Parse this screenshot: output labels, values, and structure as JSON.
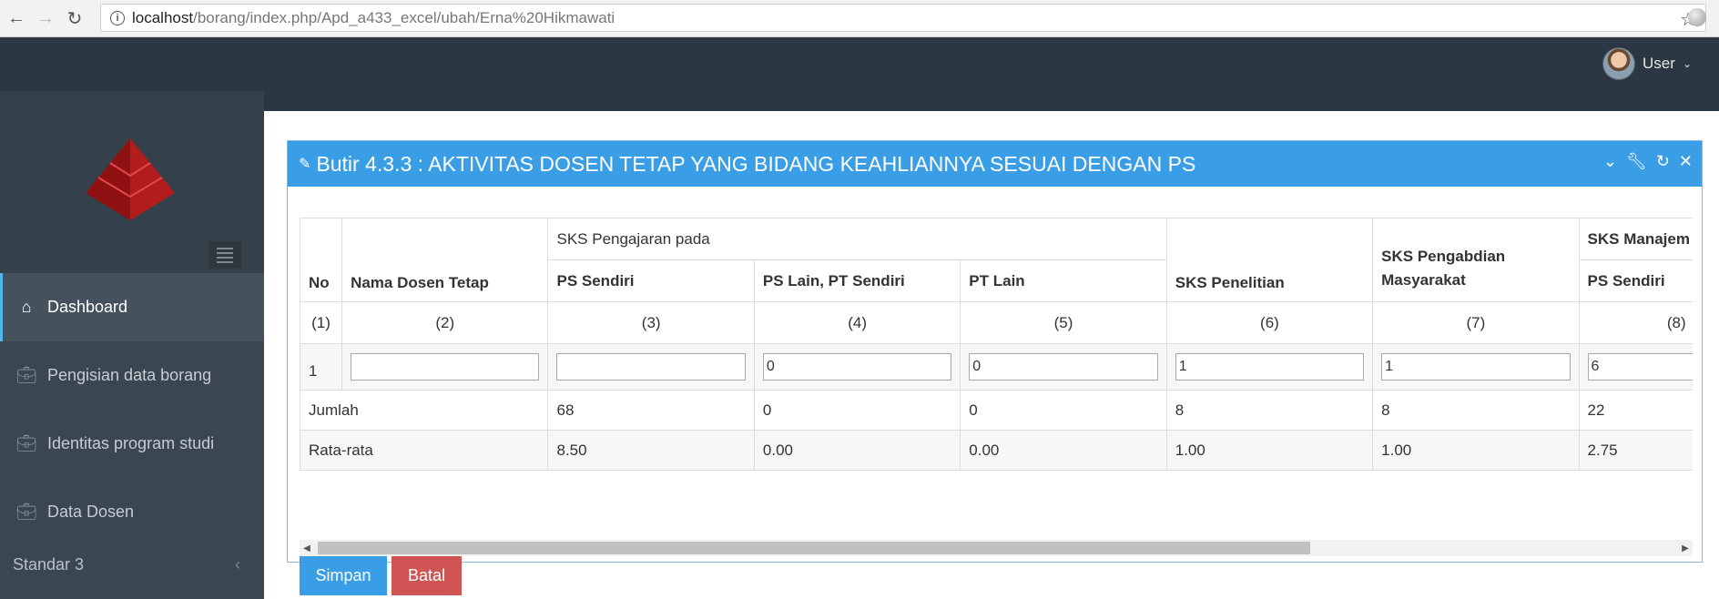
{
  "browser": {
    "url_host": "localhost",
    "url_path": "/borang/index.php/Apd_a433_excel/ubah/Erna%20Hikmawati"
  },
  "header": {
    "user_label": "User"
  },
  "sidebar": {
    "items": [
      {
        "label": "Dashboard",
        "icon": "home-icon"
      },
      {
        "label": "Pengisian data borang",
        "icon": "briefcase-icon"
      },
      {
        "label": "Identitas program studi",
        "icon": "briefcase-icon"
      },
      {
        "label": "Data Dosen",
        "icon": "briefcase-icon"
      }
    ],
    "section": "Standar 3"
  },
  "panel": {
    "title": "Butir 4.3.3 : AKTIVITAS DOSEN TETAP YANG BIDANG KEAHLIANNYA SESUAI DENGAN PS"
  },
  "table": {
    "headers": {
      "no": "No",
      "nama": "Nama Dosen Tetap",
      "sks_pengajaran": "SKS Pengajaran pada",
      "ps_sendiri": "PS Sendiri",
      "ps_lain": "PS Lain, PT Sendiri",
      "pt_lain": "PT Lain",
      "penelitian": "SKS Penelitian",
      "pengabdian": "SKS Pengabdian Masyarakat",
      "manajemen": "SKS Manajem",
      "manajemen_ps": "PS Sendiri"
    },
    "col_numbers": [
      "(1)",
      "(2)",
      "(3)",
      "(4)",
      "(5)",
      "(6)",
      "(7)",
      "(8)"
    ],
    "input_row": {
      "no": "1",
      "nama": "",
      "ps_sendiri": "",
      "ps_lain": "0",
      "pt_lain": "0",
      "penelitian": "1",
      "pengabdian": "1",
      "manajemen": "6"
    },
    "jumlah": {
      "label": "Jumlah",
      "values": [
        "68",
        "0",
        "0",
        "8",
        "8",
        "22"
      ]
    },
    "rata": {
      "label": "Rata-rata",
      "values": [
        "8.50",
        "0.00",
        "0.00",
        "1.00",
        "1.00",
        "2.75"
      ]
    }
  },
  "buttons": {
    "save": "Simpan",
    "cancel": "Batal"
  }
}
